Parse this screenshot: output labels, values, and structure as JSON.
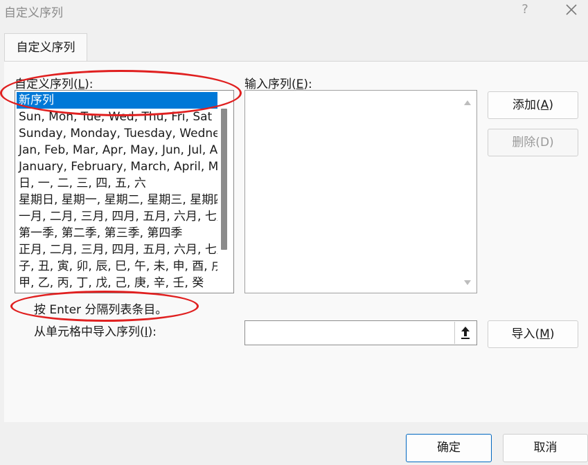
{
  "window": {
    "title": "自定义序列",
    "help_glyph": "?"
  },
  "tabs": [
    {
      "label": "自定义序列"
    }
  ],
  "list_label": {
    "text": "自定义序列(",
    "key": "L",
    "suffix": "):"
  },
  "entries_label": {
    "text": "输入序列(",
    "key": "E",
    "suffix": "):"
  },
  "custom_lists": [
    "新序列",
    "Sun, Mon, Tue, Wed, Thu, Fri, Sat",
    "Sunday, Monday, Tuesday, Wednesday, Thursday, Friday, Saturday",
    "Jan, Feb, Mar, Apr, May, Jun, Jul, Aug, Sep, Oct, Nov, Dec",
    "January, February, March, April, May, June, July, August, September, October, November, December",
    "日, 一, 二, 三, 四, 五, 六",
    "星期日, 星期一, 星期二, 星期三, 星期四, 星期五, 星期六",
    "一月, 二月, 三月, 四月, 五月, 六月, 七月, 八月, 九月, 十月, 十一月, 十二月",
    "第一季, 第二季, 第三季, 第四季",
    "正月, 二月, 三月, 四月, 五月, 六月, 七月, 八月, 九月, 十月, 冬月, 腊月",
    "子, 丑, 寅, 卯, 辰, 巳, 午, 未, 申, 酉, 戌, 亥",
    "甲, 乙, 丙, 丁, 戊, 己, 庚, 辛, 壬, 癸"
  ],
  "selected_index": 0,
  "buttons": {
    "add": {
      "text": "添加(",
      "key": "A",
      "suffix": ")"
    },
    "delete": {
      "text": "删除(D)"
    },
    "import": {
      "text": "导入(",
      "key": "M",
      "suffix": ")"
    },
    "ok": "确定",
    "cancel": "取消"
  },
  "hint": "按 Enter 分隔列表条目。",
  "import_label": {
    "text": "从单元格中导入序列(",
    "key": "I",
    "suffix": "):"
  },
  "import_field_value": "",
  "entries_value": "",
  "colors": {
    "selection": "#0078d7",
    "annotation": "#e02020",
    "primary_border": "#0067c0"
  }
}
